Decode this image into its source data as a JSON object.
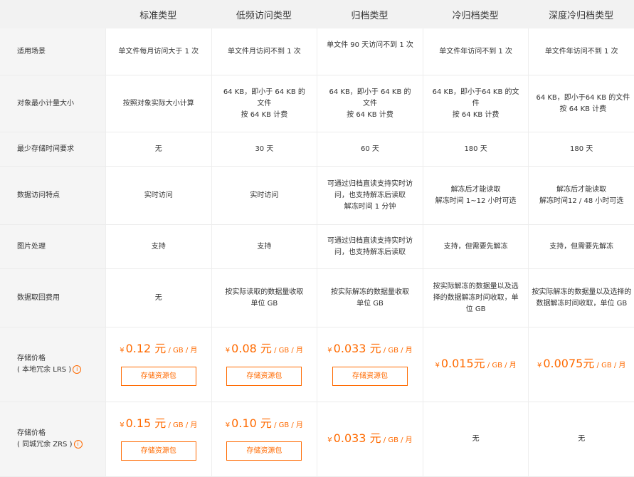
{
  "header": {
    "columns": [
      "",
      "标准类型",
      "低频访问类型",
      "归档类型",
      "冷归档类型",
      "深度冷归档类型"
    ]
  },
  "rows": [
    {
      "label": "适用场景",
      "values": [
        "单文件每月访问大于 1 次",
        "单文件月访问不到 1 次",
        "单文件 90 天访问不到 1 次",
        "单文件年访问不到 1 次",
        "单文件年访问不到 1 次"
      ]
    },
    {
      "label": "对象最小计量大小",
      "values": [
        "按照对象实际大小计算",
        "64 KB，即小于 64 KB 的文件\n按 64 KB 计费",
        "64 KB，即小于 64 KB 的文件\n按 64 KB 计费",
        "64 KB，即小于64 KB 的文件\n按 64 KB 计费",
        "64 KB，即小于64 KB 的文件\n按 64 KB 计费"
      ]
    },
    {
      "label": "最少存储时间要求",
      "values": [
        "无",
        "30 天",
        "60 天",
        "180 天",
        "180 天"
      ]
    },
    {
      "label": "数据访问特点",
      "values": [
        "实时访问",
        "实时访问",
        "可通过归档直读支持实时访问，也支持解冻后读取\n解冻时间 1 分钟",
        "解冻后才能读取\n解冻时间 1~12 小时可选",
        "解冻后才能读取\n解冻时间12 / 48 小时可选"
      ]
    },
    {
      "label": "图片处理",
      "values": [
        "支持",
        "支持",
        "可通过归档直读支持实时访问，也支持解冻后读取",
        "支持，但需要先解冻",
        "支持，但需要先解冻"
      ]
    },
    {
      "label": "数据取回费用",
      "values": [
        "无",
        "按实际读取的数据量收取\n单位 GB",
        "按实际解冻的数据量收取\n单位 GB",
        "按实际解冻的数据量以及选择的数据解冻时间收取，单位 GB",
        "按实际解冻的数据量以及选择的数据解冻时间收取，单位 GB"
      ]
    }
  ],
  "price_rows": [
    {
      "label": "存储价格",
      "sublabel": "( 本地冗余 LRS )",
      "info_icon": "i",
      "cells": [
        {
          "currency": "¥",
          "amount": "0.12 元",
          "unit": "/ GB / 月",
          "button": "存储资源包"
        },
        {
          "currency": "¥",
          "amount": "0.08 元",
          "unit": "/ GB / 月",
          "button": "存储资源包"
        },
        {
          "currency": "¥",
          "amount": "0.033 元",
          "unit": "/ GB / 月",
          "button": "存储资源包"
        },
        {
          "currency": "¥",
          "amount": "0.015元",
          "unit": "/ GB / 月",
          "button": ""
        },
        {
          "currency": "¥",
          "amount": "0.0075元",
          "unit": "/ GB / 月",
          "button": ""
        }
      ]
    },
    {
      "label": "存储价格",
      "sublabel": "( 同城冗余 ZRS )",
      "info_icon": "i",
      "cells": [
        {
          "currency": "¥",
          "amount": "0.15 元",
          "unit": "/ GB / 月",
          "button": "存储资源包"
        },
        {
          "currency": "¥",
          "amount": "0.10 元",
          "unit": "/ GB / 月",
          "button": "存储资源包"
        },
        {
          "currency": "¥",
          "amount": "0.033 元",
          "unit": "/ GB / 月",
          "button": ""
        },
        {
          "text": "无"
        },
        {
          "text": "无"
        }
      ]
    }
  ],
  "colors": {
    "accent": "#ff6a00",
    "label_bg": "#f5f5f5",
    "cell_bg": "#ffffff",
    "header_bg": "#f2f2f2"
  }
}
